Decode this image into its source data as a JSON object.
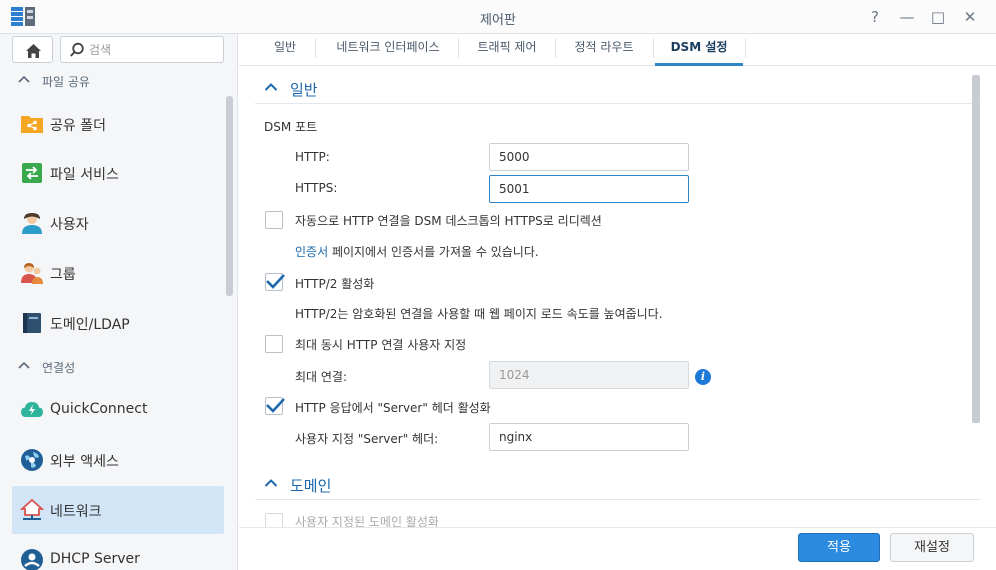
{
  "window": {
    "title": "제어판",
    "help": "?",
    "minimize": "—",
    "maximize": "□",
    "close": "✕"
  },
  "sidebar": {
    "search_placeholder": "검색",
    "sections": [
      {
        "label": "파일 공유"
      },
      {
        "label": "연결성"
      }
    ],
    "items": [
      {
        "label": "공유 폴더",
        "icon": "shared-folder-icon"
      },
      {
        "label": "파일 서비스",
        "icon": "file-services-icon"
      },
      {
        "label": "사용자",
        "icon": "user-icon"
      },
      {
        "label": "그룹",
        "icon": "group-icon"
      },
      {
        "label": "도메인/LDAP",
        "icon": "domain-ldap-icon"
      },
      {
        "label": "QuickConnect",
        "icon": "quickconnect-icon"
      },
      {
        "label": "외부 액세스",
        "icon": "external-access-icon"
      },
      {
        "label": "네트워크",
        "icon": "network-icon",
        "active": true
      },
      {
        "label": "DHCP Server",
        "icon": "dhcp-server-icon"
      }
    ]
  },
  "tabs": [
    {
      "label": "일반"
    },
    {
      "label": "네트워크 인터페이스"
    },
    {
      "label": "트래픽 제어"
    },
    {
      "label": "정적 라우트"
    },
    {
      "label": "DSM 설정",
      "active": true
    }
  ],
  "general": {
    "title": "일반",
    "dsm_port_label": "DSM 포트",
    "http_label": "HTTP:",
    "http_value": "5000",
    "https_label": "HTTPS:",
    "https_value": "5001",
    "redirect_label": "자동으로 HTTP 연결을 DSM 데스크톱의 HTTPS로 리디렉션",
    "redirect_checked": false,
    "cert_link": "인증서",
    "cert_text": " 페이지에서 인증서를 가져올 수 있습니다.",
    "http2_label": "HTTP/2 활성화",
    "http2_checked": true,
    "http2_desc": "HTTP/2는 암호화된 연결을 사용할 때 웹 페이지 로드 속도를 높여줍니다.",
    "max_conn_enable_label": "최대 동시 HTTP 연결 사용자 지정",
    "max_conn_enable_checked": false,
    "max_conn_label": "최대 연결:",
    "max_conn_value": "1024",
    "server_header_label": "HTTP 응답에서 \"Server\" 헤더 활성화",
    "server_header_checked": true,
    "custom_server_label": "사용자 지정 \"Server\" 헤더:",
    "custom_server_value": "nginx"
  },
  "domain": {
    "title": "도메인",
    "partial_label": "사용자 지정된 도메인 활성화"
  },
  "footer": {
    "apply": "적용",
    "reset": "재설정"
  },
  "colors": {
    "accent": "#2c8be0",
    "active_nav": "#d2e5f7",
    "section_title": "#1e69ad"
  }
}
